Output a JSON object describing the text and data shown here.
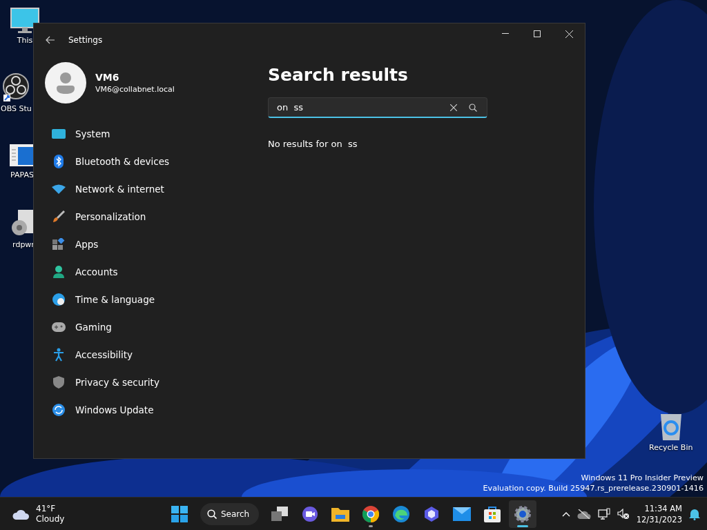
{
  "desktop_icons": [
    {
      "label": "This"
    },
    {
      "label": "OBS Stu"
    },
    {
      "label": "PAPAS"
    },
    {
      "label": "rdpwr"
    },
    {
      "label": "Recycle Bin"
    }
  ],
  "window": {
    "title": "Settings",
    "user": {
      "name": "VM6",
      "email": "VM6@collabnet.local"
    },
    "sidebar": {
      "items": [
        {
          "label": "System",
          "selected": false
        },
        {
          "label": "Bluetooth & devices",
          "selected": false
        },
        {
          "label": "Network & internet",
          "selected": false
        },
        {
          "label": "Personalization",
          "selected": false
        },
        {
          "label": "Apps",
          "selected": false
        },
        {
          "label": "Accounts",
          "selected": false
        },
        {
          "label": "Time & language",
          "selected": false
        },
        {
          "label": "Gaming",
          "selected": false
        },
        {
          "label": "Accessibility",
          "selected": false
        },
        {
          "label": "Privacy & security",
          "selected": false
        },
        {
          "label": "Windows Update",
          "selected": false
        }
      ]
    },
    "heading": "Search results",
    "search": {
      "value": "on  ss"
    },
    "message": "No results for on  ss"
  },
  "watermark": [
    "Windows 11 Pro Insider Preview",
    "Evaluation copy. Build 25947.rs_prerelease.230901-1416"
  ],
  "taskbar": {
    "weather": {
      "temperature": "41°F",
      "condition": "Cloudy"
    },
    "search_label": "Search",
    "apps": [
      {
        "open": false,
        "focused": false
      },
      {
        "open": false,
        "focused": false
      },
      {
        "open": false,
        "focused": false
      },
      {
        "open": true,
        "focused": false
      },
      {
        "open": false,
        "focused": false
      },
      {
        "open": false,
        "focused": false
      },
      {
        "open": false,
        "focused": false
      },
      {
        "open": false,
        "focused": false
      },
      {
        "open": true,
        "focused": true
      }
    ],
    "time": "11:34 AM",
    "date": "12/31/2023"
  }
}
